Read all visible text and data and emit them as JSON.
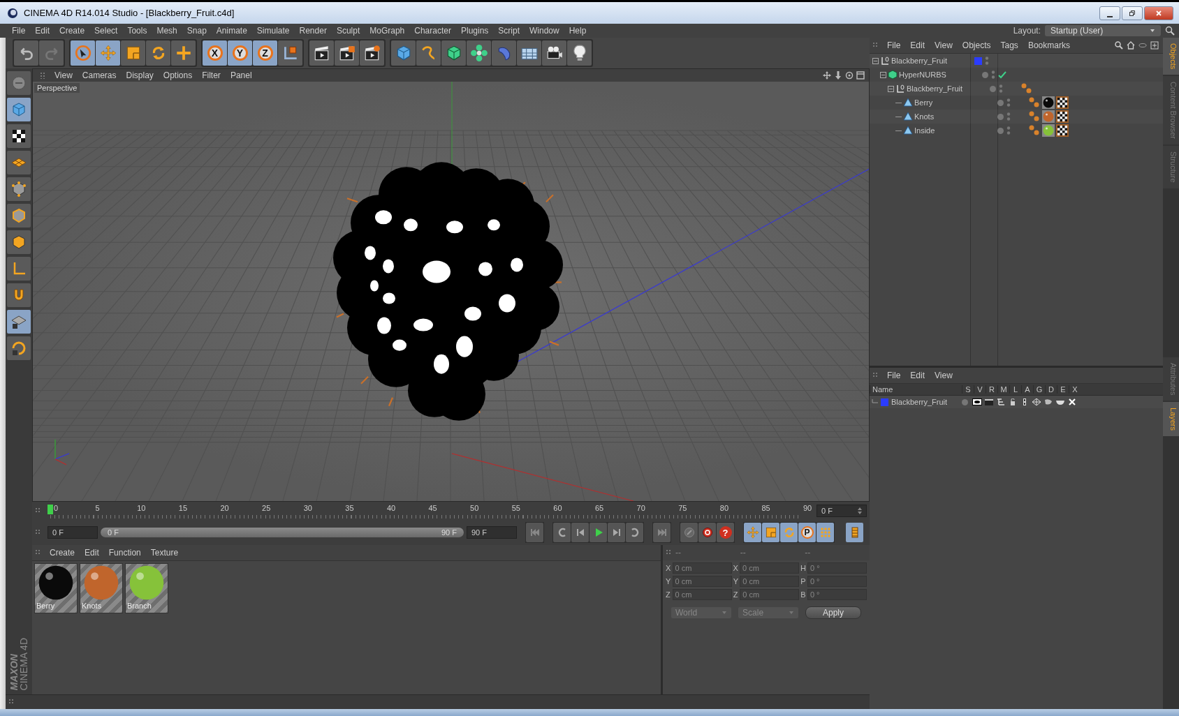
{
  "window": {
    "title": "CINEMA 4D R14.014 Studio - [Blackberry_Fruit.c4d]"
  },
  "menu": [
    "File",
    "Edit",
    "Create",
    "Select",
    "Tools",
    "Mesh",
    "Snap",
    "Animate",
    "Simulate",
    "Render",
    "Sculpt",
    "MoGraph",
    "Character",
    "Plugins",
    "Script",
    "Window",
    "Help"
  ],
  "layout": {
    "label": "Layout:",
    "value": "Startup (User)"
  },
  "toolbar_groups": [
    [
      {
        "kind": "undo",
        "selected": false
      },
      {
        "kind": "redo",
        "selected": false
      }
    ],
    [
      {
        "kind": "select",
        "selected": true
      },
      {
        "kind": "move",
        "selected": true
      },
      {
        "kind": "scale",
        "selected": false
      },
      {
        "kind": "rotate",
        "selected": false
      },
      {
        "kind": "add",
        "selected": false
      }
    ],
    [
      {
        "kind": "axis",
        "label": "X",
        "selected": true
      },
      {
        "kind": "axis",
        "label": "Y",
        "selected": true
      },
      {
        "kind": "axis",
        "label": "Z",
        "selected": true
      },
      {
        "kind": "coordinate-system",
        "selected": false
      }
    ],
    [
      {
        "kind": "render-view",
        "selected": false
      },
      {
        "kind": "render-picture",
        "selected": false
      },
      {
        "kind": "render-settings",
        "selected": false
      }
    ],
    [
      {
        "kind": "cube",
        "selected": false
      },
      {
        "kind": "spline",
        "selected": false
      },
      {
        "kind": "nurbs",
        "selected": false
      },
      {
        "kind": "cloner",
        "selected": false
      },
      {
        "kind": "deformer",
        "selected": false
      },
      {
        "kind": "floor",
        "selected": false
      },
      {
        "kind": "camera",
        "selected": false
      },
      {
        "kind": "light",
        "selected": false
      }
    ]
  ],
  "left_toolbar": [
    {
      "kind": "solo",
      "selected": false
    },
    {
      "kind": "model",
      "selected": true
    },
    {
      "kind": "texture",
      "selected": false
    },
    {
      "kind": "workplane",
      "selected": false
    },
    {
      "kind": "points",
      "selected": false
    },
    {
      "kind": "edges",
      "selected": false
    },
    {
      "kind": "polygons",
      "selected": false
    },
    {
      "kind": "axes",
      "selected": false
    },
    {
      "kind": "magnet",
      "selected": false
    },
    {
      "kind": "lock-grid",
      "selected": true
    },
    {
      "kind": "lock-rotate",
      "selected": false
    }
  ],
  "viewport": {
    "menu": [
      "View",
      "Cameras",
      "Display",
      "Options",
      "Filter",
      "Panel"
    ],
    "label": "Perspective"
  },
  "timeline": {
    "ticks": [
      "0",
      "5",
      "10",
      "15",
      "20",
      "25",
      "30",
      "35",
      "40",
      "45",
      "50",
      "55",
      "60",
      "65",
      "70",
      "75",
      "80",
      "85",
      "90"
    ],
    "level": 0,
    "current": "0 F"
  },
  "playback": {
    "start": "0 F",
    "range_start": "0 F",
    "range_end": "90 F",
    "level": 1,
    "end": "90 F"
  },
  "key_buttons": [
    {
      "kind": "key-selection"
    },
    {
      "kind": "record"
    },
    {
      "kind": "autokey",
      "label": "?"
    }
  ],
  "key_toggles": [
    {
      "kind": "move",
      "selected": true
    },
    {
      "kind": "scale",
      "selected": true
    },
    {
      "kind": "rotate",
      "selected": true
    },
    {
      "kind": "param",
      "label": "P",
      "selected": true
    },
    {
      "kind": "points",
      "selected": true
    }
  ],
  "materials": {
    "menu": [
      "Create",
      "Edit",
      "Function",
      "Texture"
    ],
    "items": [
      {
        "name": "Berry",
        "color": "#0a0a0a"
      },
      {
        "name": "Knots",
        "color": "#c0652c"
      },
      {
        "name": "Branch",
        "color": "#86c23a"
      }
    ]
  },
  "coordinates": {
    "headers": [
      "--",
      "--",
      "--"
    ],
    "rows": [
      [
        {
          "label": "X",
          "value": "0 cm"
        },
        {
          "label": "X",
          "value": "0 cm"
        },
        {
          "label": "H",
          "value": "0 °"
        }
      ],
      [
        {
          "label": "Y",
          "value": "0 cm"
        },
        {
          "label": "Y",
          "value": "0 cm"
        },
        {
          "label": "P",
          "value": "0 °"
        }
      ],
      [
        {
          "label": "Z",
          "value": "0 cm"
        },
        {
          "label": "Z",
          "value": "0 cm"
        },
        {
          "label": "B",
          "value": "0 °"
        }
      ]
    ],
    "dropdowns": [
      "World",
      "Scale"
    ],
    "apply": "Apply"
  },
  "object_manager": {
    "menu": [
      "File",
      "Edit",
      "View",
      "Objects",
      "Tags",
      "Bookmarks"
    ],
    "objects": [
      {
        "name": "Blackberry_Fruit",
        "kind": "null",
        "expanded": true,
        "color": "#2b3cff",
        "children": [
          {
            "name": "HyperNURBS",
            "kind": "nurbs",
            "expanded": true,
            "enabled": true,
            "children": [
              {
                "name": "Blackberry_Fruit",
                "kind": "null",
                "expanded": true,
                "tags": [
                  {
                    "kind": "phong"
                  }
                ],
                "children": [
                  {
                    "name": "Berry",
                    "kind": "polygon",
                    "tags": [
                      {
                        "kind": "phong"
                      },
                      {
                        "kind": "material",
                        "color": "#0a0a0a"
                      },
                      {
                        "kind": "uvw"
                      }
                    ]
                  },
                  {
                    "name": "Knots",
                    "kind": "polygon",
                    "tags": [
                      {
                        "kind": "phong"
                      },
                      {
                        "kind": "material",
                        "color": "#c0652c"
                      },
                      {
                        "kind": "uvw"
                      }
                    ]
                  },
                  {
                    "name": "Inside",
                    "kind": "polygon",
                    "tags": [
                      {
                        "kind": "phong"
                      },
                      {
                        "kind": "material",
                        "color": "#86c23a"
                      },
                      {
                        "kind": "uvw"
                      }
                    ]
                  }
                ]
              }
            ]
          }
        ]
      }
    ]
  },
  "layer_manager": {
    "menu": [
      "File",
      "Edit",
      "View"
    ],
    "columns": [
      "Name",
      "S",
      "V",
      "R",
      "M",
      "L",
      "A",
      "G",
      "D",
      "E",
      "X"
    ],
    "layers": [
      {
        "name": "Blackberry_Fruit",
        "color": "#2b3cff"
      }
    ]
  },
  "side_tabs": [
    {
      "label": "Objects",
      "selected": true
    },
    {
      "label": "Content Browser",
      "selected": false
    },
    {
      "label": "Structure",
      "selected": false
    },
    {
      "label": "Attributes",
      "selected": false
    },
    {
      "label": "Layers",
      "selected": true
    }
  ],
  "logo": {
    "brand": "MAXON",
    "product": "CINEMA 4D"
  }
}
